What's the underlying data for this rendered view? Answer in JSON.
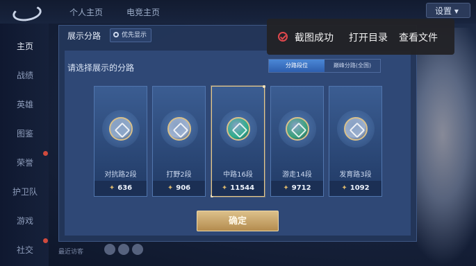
{
  "topbar": {
    "tabs": [
      "个人主页",
      "电竞主页"
    ],
    "settings_label": "设置"
  },
  "sidebar": {
    "items": [
      {
        "label": "主页",
        "active": true
      },
      {
        "label": "战绩"
      },
      {
        "label": "英雄"
      },
      {
        "label": "图鉴"
      },
      {
        "label": "荣誉"
      },
      {
        "label": "护卫队"
      },
      {
        "label": "游戏"
      },
      {
        "label": "社交"
      }
    ]
  },
  "recent_label": "最近访客",
  "modal": {
    "title": "展示分路",
    "priority_label": "优先显示",
    "subtitle": "请选择展示的分路",
    "segments": [
      "分路段位",
      "巅峰分路(全国)"
    ],
    "active_segment": 0,
    "cards": [
      {
        "name": "对抗路2段",
        "score": "636",
        "emblem_color": "#8fa9c9"
      },
      {
        "name": "打野2段",
        "score": "906",
        "emblem_color": "#9fb3d2"
      },
      {
        "name": "中路16段",
        "score": "11544",
        "emblem_color": "#2fae8c",
        "selected": true
      },
      {
        "name": "游走14段",
        "score": "9712",
        "emblem_color": "#3aa27c"
      },
      {
        "name": "发育路3段",
        "score": "1092",
        "emblem_color": "#9cb0cf"
      }
    ],
    "confirm_label": "确定"
  },
  "toast": {
    "message": "截图成功",
    "open_dir": "打开目录",
    "view_file": "查看文件",
    "icon": "check-circle-icon",
    "icon_color": "#e0484d"
  }
}
